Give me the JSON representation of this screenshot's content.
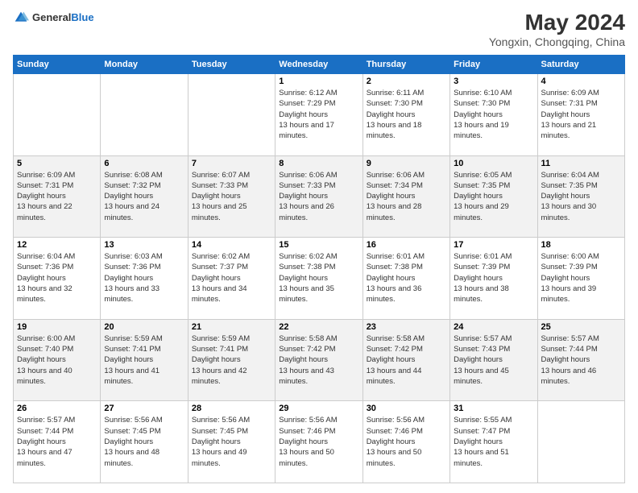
{
  "header": {
    "logo_general": "General",
    "logo_blue": "Blue",
    "month": "May 2024",
    "location": "Yongxin, Chongqing, China"
  },
  "weekdays": [
    "Sunday",
    "Monday",
    "Tuesday",
    "Wednesday",
    "Thursday",
    "Friday",
    "Saturday"
  ],
  "weeks": [
    [
      {
        "day": "",
        "sunrise": "",
        "sunset": "",
        "daylight": ""
      },
      {
        "day": "",
        "sunrise": "",
        "sunset": "",
        "daylight": ""
      },
      {
        "day": "",
        "sunrise": "",
        "sunset": "",
        "daylight": ""
      },
      {
        "day": "1",
        "sunrise": "6:12 AM",
        "sunset": "7:29 PM",
        "daylight": "13 hours and 17 minutes."
      },
      {
        "day": "2",
        "sunrise": "6:11 AM",
        "sunset": "7:30 PM",
        "daylight": "13 hours and 18 minutes."
      },
      {
        "day": "3",
        "sunrise": "6:10 AM",
        "sunset": "7:30 PM",
        "daylight": "13 hours and 19 minutes."
      },
      {
        "day": "4",
        "sunrise": "6:09 AM",
        "sunset": "7:31 PM",
        "daylight": "13 hours and 21 minutes."
      }
    ],
    [
      {
        "day": "5",
        "sunrise": "6:09 AM",
        "sunset": "7:31 PM",
        "daylight": "13 hours and 22 minutes."
      },
      {
        "day": "6",
        "sunrise": "6:08 AM",
        "sunset": "7:32 PM",
        "daylight": "13 hours and 24 minutes."
      },
      {
        "day": "7",
        "sunrise": "6:07 AM",
        "sunset": "7:33 PM",
        "daylight": "13 hours and 25 minutes."
      },
      {
        "day": "8",
        "sunrise": "6:06 AM",
        "sunset": "7:33 PM",
        "daylight": "13 hours and 26 minutes."
      },
      {
        "day": "9",
        "sunrise": "6:06 AM",
        "sunset": "7:34 PM",
        "daylight": "13 hours and 28 minutes."
      },
      {
        "day": "10",
        "sunrise": "6:05 AM",
        "sunset": "7:35 PM",
        "daylight": "13 hours and 29 minutes."
      },
      {
        "day": "11",
        "sunrise": "6:04 AM",
        "sunset": "7:35 PM",
        "daylight": "13 hours and 30 minutes."
      }
    ],
    [
      {
        "day": "12",
        "sunrise": "6:04 AM",
        "sunset": "7:36 PM",
        "daylight": "13 hours and 32 minutes."
      },
      {
        "day": "13",
        "sunrise": "6:03 AM",
        "sunset": "7:36 PM",
        "daylight": "13 hours and 33 minutes."
      },
      {
        "day": "14",
        "sunrise": "6:02 AM",
        "sunset": "7:37 PM",
        "daylight": "13 hours and 34 minutes."
      },
      {
        "day": "15",
        "sunrise": "6:02 AM",
        "sunset": "7:38 PM",
        "daylight": "13 hours and 35 minutes."
      },
      {
        "day": "16",
        "sunrise": "6:01 AM",
        "sunset": "7:38 PM",
        "daylight": "13 hours and 36 minutes."
      },
      {
        "day": "17",
        "sunrise": "6:01 AM",
        "sunset": "7:39 PM",
        "daylight": "13 hours and 38 minutes."
      },
      {
        "day": "18",
        "sunrise": "6:00 AM",
        "sunset": "7:39 PM",
        "daylight": "13 hours and 39 minutes."
      }
    ],
    [
      {
        "day": "19",
        "sunrise": "6:00 AM",
        "sunset": "7:40 PM",
        "daylight": "13 hours and 40 minutes."
      },
      {
        "day": "20",
        "sunrise": "5:59 AM",
        "sunset": "7:41 PM",
        "daylight": "13 hours and 41 minutes."
      },
      {
        "day": "21",
        "sunrise": "5:59 AM",
        "sunset": "7:41 PM",
        "daylight": "13 hours and 42 minutes."
      },
      {
        "day": "22",
        "sunrise": "5:58 AM",
        "sunset": "7:42 PM",
        "daylight": "13 hours and 43 minutes."
      },
      {
        "day": "23",
        "sunrise": "5:58 AM",
        "sunset": "7:42 PM",
        "daylight": "13 hours and 44 minutes."
      },
      {
        "day": "24",
        "sunrise": "5:57 AM",
        "sunset": "7:43 PM",
        "daylight": "13 hours and 45 minutes."
      },
      {
        "day": "25",
        "sunrise": "5:57 AM",
        "sunset": "7:44 PM",
        "daylight": "13 hours and 46 minutes."
      }
    ],
    [
      {
        "day": "26",
        "sunrise": "5:57 AM",
        "sunset": "7:44 PM",
        "daylight": "13 hours and 47 minutes."
      },
      {
        "day": "27",
        "sunrise": "5:56 AM",
        "sunset": "7:45 PM",
        "daylight": "13 hours and 48 minutes."
      },
      {
        "day": "28",
        "sunrise": "5:56 AM",
        "sunset": "7:45 PM",
        "daylight": "13 hours and 49 minutes."
      },
      {
        "day": "29",
        "sunrise": "5:56 AM",
        "sunset": "7:46 PM",
        "daylight": "13 hours and 50 minutes."
      },
      {
        "day": "30",
        "sunrise": "5:56 AM",
        "sunset": "7:46 PM",
        "daylight": "13 hours and 50 minutes."
      },
      {
        "day": "31",
        "sunrise": "5:55 AM",
        "sunset": "7:47 PM",
        "daylight": "13 hours and 51 minutes."
      },
      {
        "day": "",
        "sunrise": "",
        "sunset": "",
        "daylight": ""
      }
    ]
  ]
}
